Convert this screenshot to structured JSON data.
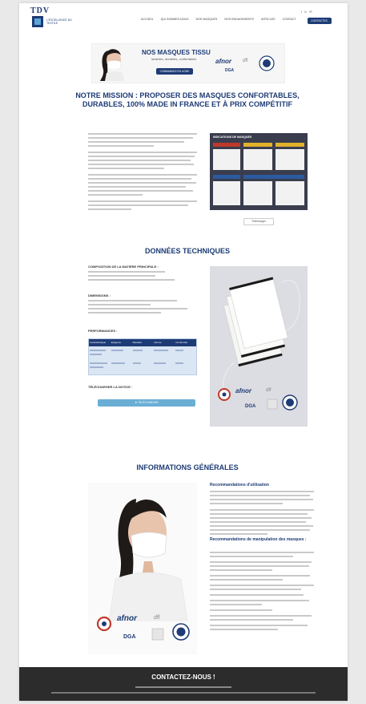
{
  "header": {
    "logo": "TDV",
    "logo_sub": "L'EXCELLENCE DU TEXTILE",
    "nav": [
      "ACCUEIL",
      "QUI SOMMES-NOUS",
      "NOS MASQUES",
      "NOS ENGAGEMENTS",
      "ARTICLES",
      "CONTACT"
    ],
    "contact_button": "CONTACTEZ-NOUS"
  },
  "banner": {
    "title": "NOS MASQUES TISSU",
    "subtitle": "lavables, durables, confortables",
    "button": "COMMANDEZ EN LIGNE"
  },
  "mission": {
    "title": "NOTRE MISSION : PROPOSER DES MASQUES CONFORTABLES, DURABLES, 100% MADE IN FRANCE ET À PRIX COMPÉTITIF",
    "table_heading": "INDICATIONS DE MASQUES",
    "download_label": "Télécharger"
  },
  "tech": {
    "title": "DONNÉES TECHNIQUES",
    "composition_heading": "COMPOSITION DE LA MATIÈRE PRINCIPALE :",
    "dimensions_heading": "DIMENSIONS :",
    "performance_heading": "PERFORMANCES :",
    "notice_heading": "TÉLÉCHARGER LA NOTICE :",
    "notice_button": "TÉLÉCHARGER",
    "perf_headers": [
      "Caractéristique",
      "Exigence",
      "Résultat",
      "Norme",
      "Conformité"
    ]
  },
  "general": {
    "title": "INFORMATIONS GÉNÉRALES",
    "reco_use": "Recommandations d'utilisation",
    "reco_handling": "Recommandations de manipulation des masques :"
  },
  "footer": {
    "title": "CONTACTEZ-NOUS !"
  },
  "colors": {
    "brand": "#1d3b75",
    "accent": "#6aaed6",
    "footer": "#2c2c2c"
  }
}
